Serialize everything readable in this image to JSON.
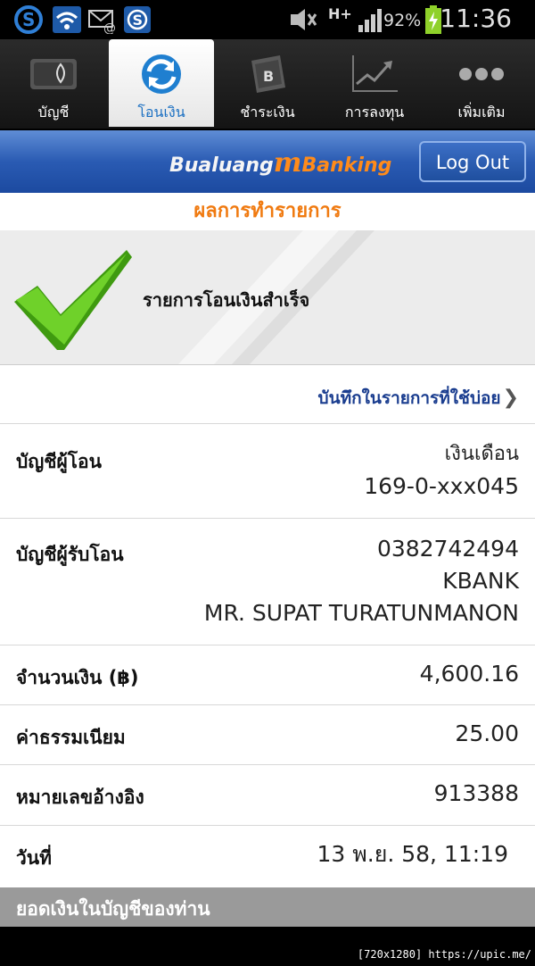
{
  "status_bar": {
    "battery_percent": "92%",
    "time": "11:36",
    "network": "H+",
    "icons": [
      "skype-icon",
      "wifi-icon",
      "email-icon",
      "skype-status-icon",
      "mute-icon",
      "signal-icon",
      "battery-icon"
    ]
  },
  "tabs": [
    {
      "label": "บัญชี",
      "icon": "wallet-icon",
      "active": false
    },
    {
      "label": "โอนเงิน",
      "icon": "transfer-refresh-icon",
      "active": true
    },
    {
      "label": "ชำระเงิน",
      "icon": "bill-payment-icon",
      "active": false
    },
    {
      "label": "การลงทุน",
      "icon": "investment-chart-icon",
      "active": false
    },
    {
      "label": "เพิ่มเติม",
      "icon": "more-dots-icon",
      "active": false
    }
  ],
  "header": {
    "brand_part1": "Bualuang",
    "brand_m": "m",
    "brand_part2": "Banking",
    "logout_label": "Log Out"
  },
  "page_title": "ผลการทำรายการ",
  "success_message": "รายการโอนเงินสำเร็จ",
  "favorite_link": "บันทึกในรายการที่ใช้บ่อย",
  "details": {
    "from_label": "บัญชีผู้โอน",
    "from_line1": "เงินเดือน",
    "from_line2": "169-0-xxx045",
    "to_label": "บัญชีผู้รับโอน",
    "to_line1": "0382742494",
    "to_line2": "KBANK",
    "to_line3": "MR. SUPAT TURATUNMANON",
    "amount_label": "จำนวนเงิน (฿)",
    "amount_value": "4,600.16",
    "fee_label": "ค่าธรรมเนียม",
    "fee_value": "25.00",
    "ref_label": "หมายเลขอ้างอิง",
    "ref_value": "913388",
    "date_label": "วันที่",
    "date_value": "13 พ.ย. 58, 11:19"
  },
  "balance_section_label": "ยอดเงินในบัญชีของท่าน",
  "watermark": "[720x1280] https://upic.me/",
  "colors": {
    "accent_orange": "#f07a10",
    "header_blue": "#2a5bb3",
    "link_blue": "#1a3d8f",
    "check_green": "#5cc21a"
  }
}
